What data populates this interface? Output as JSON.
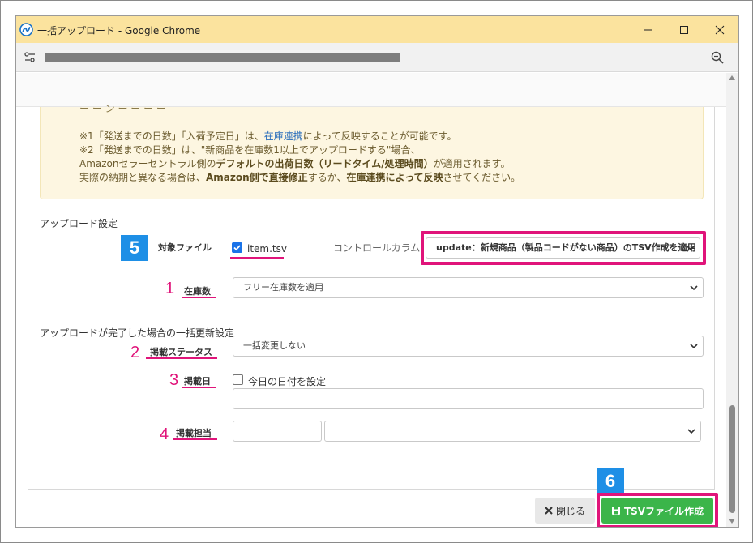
{
  "window": {
    "title": "一括アップロード - Google Chrome",
    "minimize_label": "—",
    "maximize_label": "☐",
    "close_label": "✕"
  },
  "notice": {
    "cut_line": "ー ー ン ー ー ー ー",
    "note1_prefix": "※1「発送までの日数」「入荷予定日」は、",
    "note1_link": "在庫連携",
    "note1_suffix": "によって反映することが可能です。",
    "note2": "※2「発送までの日数」は、\"新商品を在庫数1以上でアップロードする\"場合、",
    "note3_prefix": "Amazonセラーセントラル側の",
    "note3_bold": "デフォルトの出荷日数（リードタイム/処理時間）",
    "note3_suffix": "が適用されます。",
    "note4_prefix": "実際の納期と異なる場合は、",
    "note4_bold1": "Amazon側で直接修正",
    "note4_mid": "するか、",
    "note4_bold2": "在庫連携によって反映",
    "note4_suffix": "させてください。"
  },
  "upload_settings": {
    "section_title": "アップロード設定",
    "target_file_label": "対象ファイル",
    "target_file_value": "item.tsv",
    "control_column_label": "コントロールカラム：",
    "control_column_value": "update：新規商品（製品コードがない商品）のTSV作成を適用",
    "stock_label": "在庫数",
    "stock_value": "フリー在庫数を適用"
  },
  "bulk_update": {
    "section_title": "アップロードが完了した場合の一括更新設定",
    "status_label": "掲載ステータス",
    "status_value": "一括変更しない",
    "date_label": "掲載日",
    "date_checkbox_label": "今日の日付を設定",
    "owner_label": "掲載担当"
  },
  "annotations": {
    "n1": "1",
    "n2": "2",
    "n3": "3",
    "n4": "4",
    "n5": "5",
    "n6": "6"
  },
  "footer": {
    "close_label": "閉じる",
    "create_label": "TSVファイル作成"
  },
  "colors": {
    "titlebar": "#fbe39e",
    "highlight": "#e0147a",
    "badge": "#1e8fe6",
    "primary_button": "#3bb54a",
    "notice_bg": "#fdf6e1"
  }
}
